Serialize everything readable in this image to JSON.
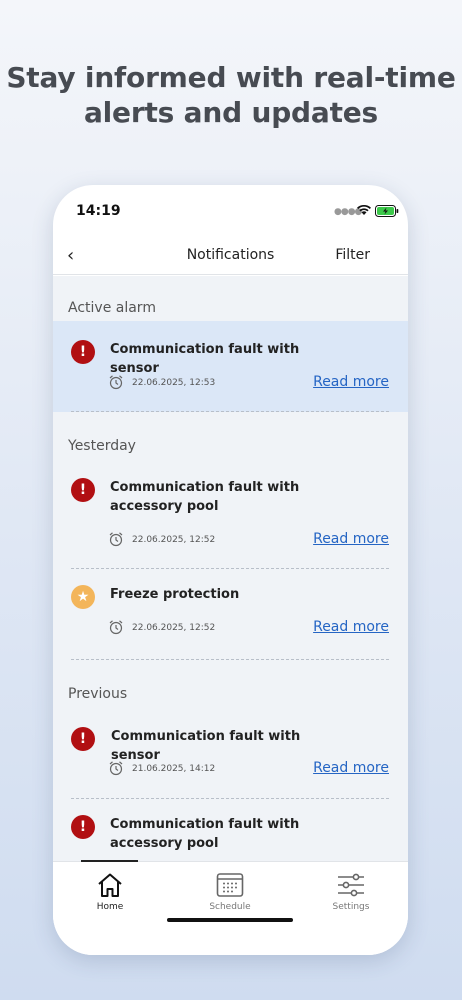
{
  "headline": {
    "line1": "Stay informed with real-time",
    "line2": "alerts and updates"
  },
  "status_bar": {
    "time": "14:19"
  },
  "navbar": {
    "title": "Notifications",
    "filter_label": "Filter"
  },
  "sections": [
    {
      "title": "Active alarm",
      "items": [
        {
          "type": "alarm",
          "title": "Communication fault with sensor",
          "date": "22.06.2025, 12:53",
          "link": "Read more",
          "active": true
        }
      ]
    },
    {
      "title": "Yesterday",
      "items": [
        {
          "type": "alarm",
          "title": "Communication fault with accessory pool",
          "date": "22.06.2025, 12:52",
          "link": "Read more"
        },
        {
          "type": "freeze",
          "title": "Freeze protection",
          "date": "22.06.2025, 12:52",
          "link": "Read more"
        }
      ]
    },
    {
      "title": "Previous",
      "items": [
        {
          "type": "alarm",
          "title": "Communication fault with sensor",
          "date": "21.06.2025, 14:12",
          "link": "Read more"
        },
        {
          "type": "alarm",
          "title": "Communication fault with accessory pool"
        }
      ]
    }
  ],
  "tabbar": {
    "home": "Home",
    "schedule": "Schedule",
    "settings": "Settings"
  },
  "icons": {
    "alarm": "exclamation-icon",
    "freeze": "star-icon",
    "date": "alarm-clock-icon"
  },
  "colors": {
    "alarm": "#b10f12",
    "freeze": "#f3b55a",
    "link": "#2565c4",
    "active_bg": "#dbe7f7"
  }
}
